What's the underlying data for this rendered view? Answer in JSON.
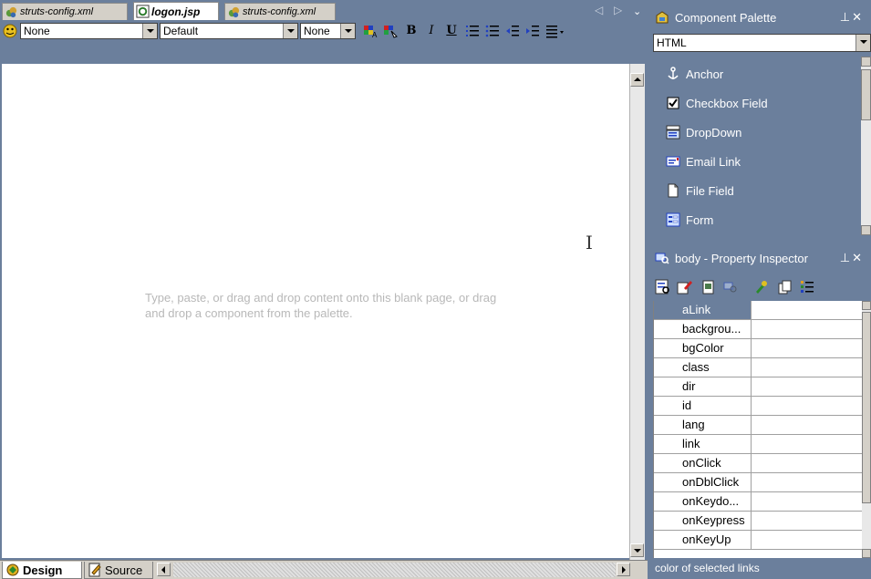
{
  "editor": {
    "tabs": [
      {
        "label": "struts-config.xml",
        "active": false
      },
      {
        "label": "logon.jsp",
        "active": true
      },
      {
        "label": "struts-config.xml",
        "active": false
      }
    ],
    "toolbar": {
      "block_format": "None",
      "font_family": "Default",
      "font_size": "None",
      "bold": "B",
      "italic": "I",
      "underline": "U"
    },
    "canvas_hint": "Type, paste, or drag and drop content onto this blank page, or drag and drop a component from the palette.",
    "view_tabs": {
      "design": "Design",
      "source": "Source"
    }
  },
  "component_palette": {
    "title": "Component Palette",
    "selected_library": "HTML",
    "items": [
      {
        "label": "Anchor",
        "icon": "anchor-icon"
      },
      {
        "label": "Checkbox Field",
        "icon": "checkbox-icon"
      },
      {
        "label": "DropDown",
        "icon": "dropdown-icon"
      },
      {
        "label": "Email Link",
        "icon": "email-icon"
      },
      {
        "label": "File Field",
        "icon": "file-icon"
      },
      {
        "label": "Form",
        "icon": "form-icon"
      }
    ]
  },
  "property_inspector": {
    "title": "body - Property Inspector",
    "properties": [
      "aLink",
      "backgrou...",
      "bgColor",
      "class",
      "dir",
      "id",
      "lang",
      "link",
      "onClick",
      "onDblClick",
      "onKeydo...",
      "onKeypress",
      "onKeyUp"
    ],
    "selected_index": 0,
    "status": "color of selected links"
  },
  "colors": {
    "panel_bg": "#6b7f9c",
    "selection": "#6b7f9c",
    "canvas": "#ffffff"
  }
}
